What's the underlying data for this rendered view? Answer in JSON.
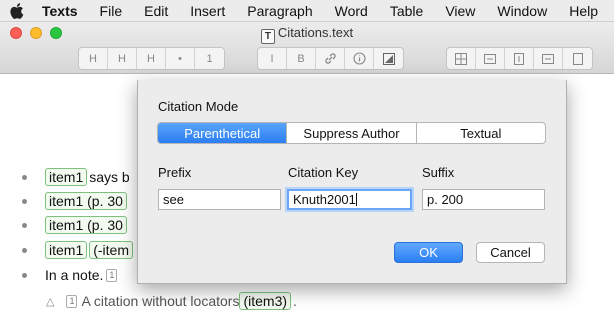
{
  "menubar": {
    "app_name": "Texts",
    "items": [
      "File",
      "Edit",
      "Insert",
      "Paragraph",
      "Word",
      "Table",
      "View",
      "Window",
      "Help"
    ]
  },
  "window": {
    "title": "Citations.text",
    "doc_icon_letter": "T"
  },
  "toolbar": {
    "group1": [
      "H",
      "H",
      "H",
      "•",
      "1"
    ],
    "group2": [
      "I",
      "B",
      "link-icon",
      "info-icon",
      "image-icon"
    ],
    "group3": [
      "table-icon",
      "row-icon",
      "column-icon",
      "cell-icon",
      "delete-icon"
    ]
  },
  "document": {
    "para1": {
      "cite": "item1",
      "text": " says b"
    },
    "para2": {
      "cite": "item1 (p. 30"
    },
    "para3": {
      "cite": "item1 (p. 30"
    },
    "para4": {
      "cite": "item1",
      "cite2": "(-item"
    },
    "para5": {
      "text": "In a note.",
      "note_marker": "1"
    },
    "note": {
      "marker": "1",
      "text": "A citation without locators ",
      "cite": "(item3)",
      "end": "."
    }
  },
  "dialog": {
    "citation_mode_label": "Citation Mode",
    "modes": [
      "Parenthetical",
      "Suppress Author",
      "Textual"
    ],
    "selected_mode": "Parenthetical",
    "prefix_label": "Prefix",
    "prefix_value": "see",
    "key_label": "Citation Key",
    "key_value": "Knuth2001",
    "suffix_label": "Suffix",
    "suffix_value": "p. 200",
    "ok_label": "OK",
    "cancel_label": "Cancel"
  },
  "colors": {
    "accent": "#2b7ef2",
    "citation_border": "#7cc27c"
  }
}
